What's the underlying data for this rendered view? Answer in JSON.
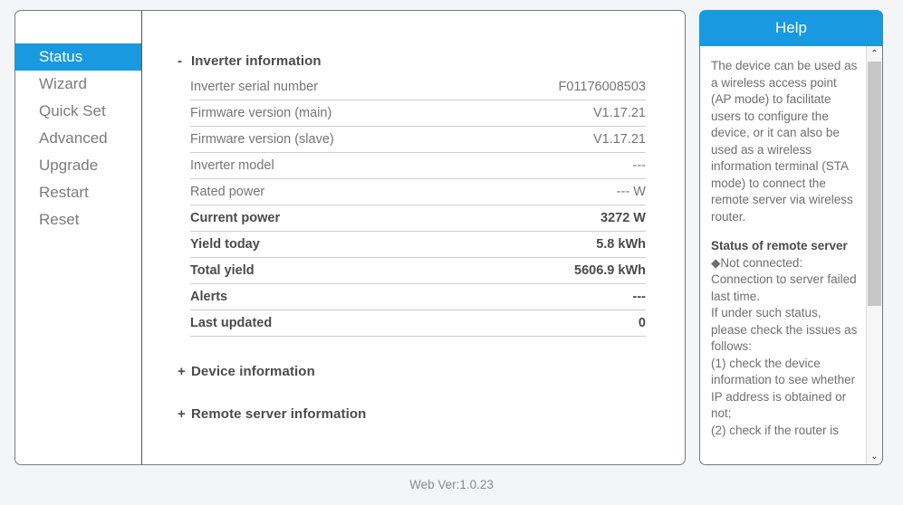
{
  "sidebar": {
    "items": [
      {
        "label": "Status",
        "active": true
      },
      {
        "label": "Wizard",
        "active": false
      },
      {
        "label": "Quick Set",
        "active": false
      },
      {
        "label": "Advanced",
        "active": false
      },
      {
        "label": "Upgrade",
        "active": false
      },
      {
        "label": "Restart",
        "active": false
      },
      {
        "label": "Reset",
        "active": false
      }
    ]
  },
  "content": {
    "inverter_section": {
      "toggle": "-",
      "title": "Inverter information",
      "rows": [
        {
          "label": "Inverter serial number",
          "value": "F01176008503",
          "bold": false
        },
        {
          "label": "Firmware version (main)",
          "value": "V1.17.21",
          "bold": false
        },
        {
          "label": "Firmware version (slave)",
          "value": "V1.17.21",
          "bold": false
        },
        {
          "label": "Inverter model",
          "value": "---",
          "bold": false
        },
        {
          "label": "Rated power",
          "value": "--- W",
          "bold": false
        },
        {
          "label": "Current power",
          "value": "3272 W",
          "bold": true
        },
        {
          "label": "Yield today",
          "value": "5.8 kWh",
          "bold": true
        },
        {
          "label": "Total yield",
          "value": "5606.9 kWh",
          "bold": true
        },
        {
          "label": "Alerts",
          "value": "---",
          "bold": true
        },
        {
          "label": "Last updated",
          "value": "0",
          "bold": true
        }
      ]
    },
    "device_section": {
      "toggle": "+",
      "title": "Device information"
    },
    "remote_section": {
      "toggle": "+",
      "title": "Remote server information"
    }
  },
  "help": {
    "title": "Help",
    "paragraph1": "The device can be used as a wireless access point (AP mode) to facilitate users to configure the device, or it can also be used as a wireless information terminal (STA mode) to connect the remote server via wireless router.",
    "heading2": "Status of remote server",
    "line1": "◆Not connected: Connection to server failed last time.",
    "line2": "If under such status, please check the issues as follows:",
    "line3": "(1) check the device information to see whether IP address is obtained or not;",
    "line4": "(2) check if the router is",
    "scroll_up_icon": "⌃",
    "scroll_down_icon": "⌄"
  },
  "footer": {
    "web_version": "Web Ver:1.0.23"
  },
  "colors": {
    "accent": "#1899e0",
    "text": "#757575",
    "heading": "#4b4b4b",
    "page_bg": "#f4f5f7"
  }
}
